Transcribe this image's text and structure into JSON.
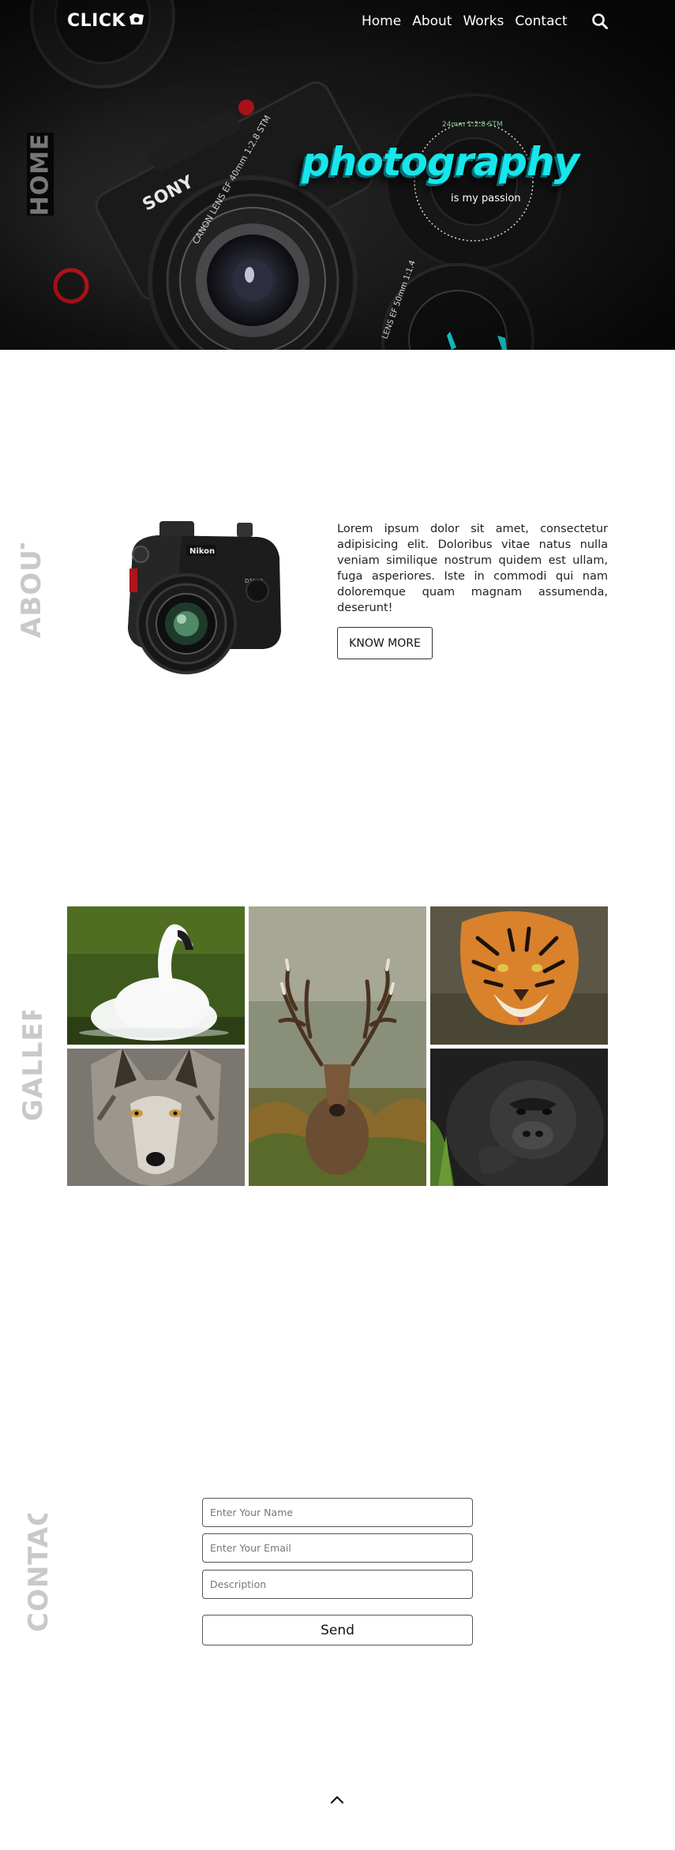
{
  "nav": {
    "logo_text": "CLICK",
    "links": [
      {
        "label": "Home"
      },
      {
        "label": "About"
      },
      {
        "label": "Works"
      },
      {
        "label": "Contact"
      }
    ]
  },
  "hero": {
    "side_label": "HOME",
    "title": "photography",
    "subtitle": "is my passion",
    "accent_color": "#17e6ea"
  },
  "about": {
    "side_label": "ABOUT",
    "body": "Lorem ipsum dolor sit amet, consectetur adipisicing elit. Doloribus vitae natus nulla veniam similique nostrum quidem est ullam, fuga asperiores. Iste in commodi qui nam doloremque quam magnam assumenda, deserunt!",
    "button_label": "KNOW MORE"
  },
  "gallery": {
    "side_label": "GALLERY",
    "images": [
      "swan",
      "deer",
      "tiger",
      "wolf",
      "gorilla"
    ]
  },
  "contact": {
    "side_label": "CONTACT",
    "name_placeholder": "Enter Your Name",
    "email_placeholder": "Enter Your Email",
    "description_placeholder": "Description",
    "send_label": "Send"
  },
  "footer": {
    "scroll_top_icon": "chevron-up-icon"
  }
}
